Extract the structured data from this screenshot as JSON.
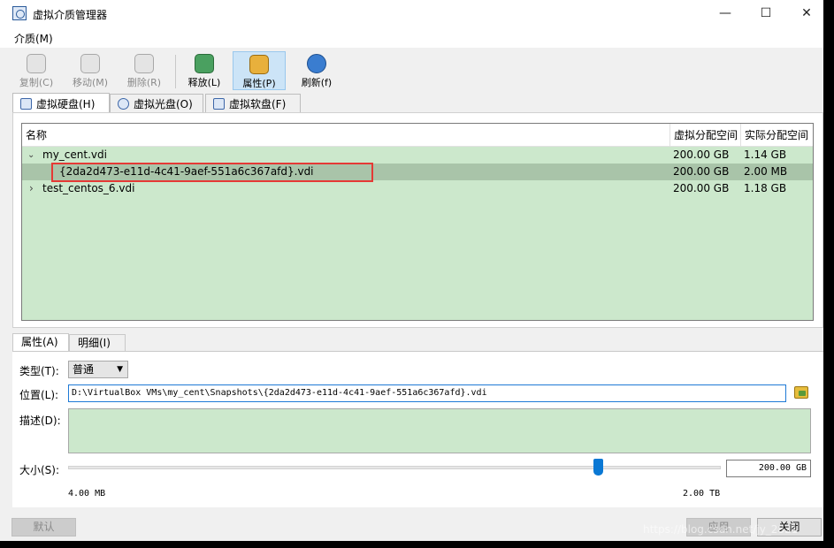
{
  "window": {
    "title": "虚拟介质管理器",
    "controls": {
      "minimize": "—",
      "maximize": "☐",
      "close": "✕"
    }
  },
  "menubar": {
    "items": [
      {
        "label": "介质(M)"
      }
    ]
  },
  "toolbar": {
    "buttons": [
      {
        "label": "复制(C)",
        "icon": "copy-icon",
        "enabled": false
      },
      {
        "label": "移动(M)",
        "icon": "move-icon",
        "enabled": false
      },
      {
        "label": "删除(R)",
        "icon": "delete-icon",
        "enabled": false
      },
      {
        "label": "释放(L)",
        "icon": "release-icon",
        "enabled": true
      },
      {
        "label": "属性(P)",
        "icon": "properties-icon",
        "enabled": true,
        "active": true
      },
      {
        "label": "刷新(f)",
        "icon": "refresh-icon",
        "enabled": true
      }
    ]
  },
  "tabs": [
    {
      "label": "虚拟硬盘(H)",
      "icon": "hard-disk-icon",
      "active": true
    },
    {
      "label": "虚拟光盘(O)",
      "icon": "optical-disc-icon",
      "active": false
    },
    {
      "label": "虚拟软盘(F)",
      "icon": "floppy-disk-icon",
      "active": false
    }
  ],
  "table": {
    "sort_indicator": "^",
    "columns": {
      "name": "名称",
      "virtual_size": "虚拟分配空间",
      "actual_size": "实际分配空间"
    },
    "rows": [
      {
        "name": "my_cent.vdi",
        "virtual_size": "200.00 GB",
        "actual_size": "1.14 GB",
        "expanded": true,
        "level": 0,
        "arrow": "⌄"
      },
      {
        "name": "{2da2d473-e11d-4c41-9aef-551a6c367afd}.vdi",
        "virtual_size": "200.00 GB",
        "actual_size": "2.00 MB",
        "level": 1,
        "selected": true
      },
      {
        "name": "test_centos_6.vdi",
        "virtual_size": "200.00 GB",
        "actual_size": "1.18 GB",
        "expanded": false,
        "level": 0,
        "arrow": "›"
      }
    ]
  },
  "bottom_tabs": [
    {
      "label": "属性(A)",
      "active": true
    },
    {
      "label": "明细(I)",
      "active": false
    }
  ],
  "properties": {
    "type_label": "类型(T):",
    "type_value": "普通",
    "location_label": "位置(L):",
    "location_value": "D:\\VirtualBox VMs\\my_cent\\Snapshots\\{2da2d473-e11d-4c41-9aef-551a6c367afd}.vdi",
    "description_label": "描述(D):",
    "description_value": "",
    "size_label": "大小(S):",
    "size_value": "200.00 GB",
    "size_min_label": "4.00 MB",
    "size_max_label": "2.00 TB",
    "size_slider_fraction": 0.81
  },
  "buttons": {
    "reset": "默认",
    "apply": "应用",
    "close": "关闭"
  },
  "watermark": "https://blog.csdn.net/jy_2821"
}
